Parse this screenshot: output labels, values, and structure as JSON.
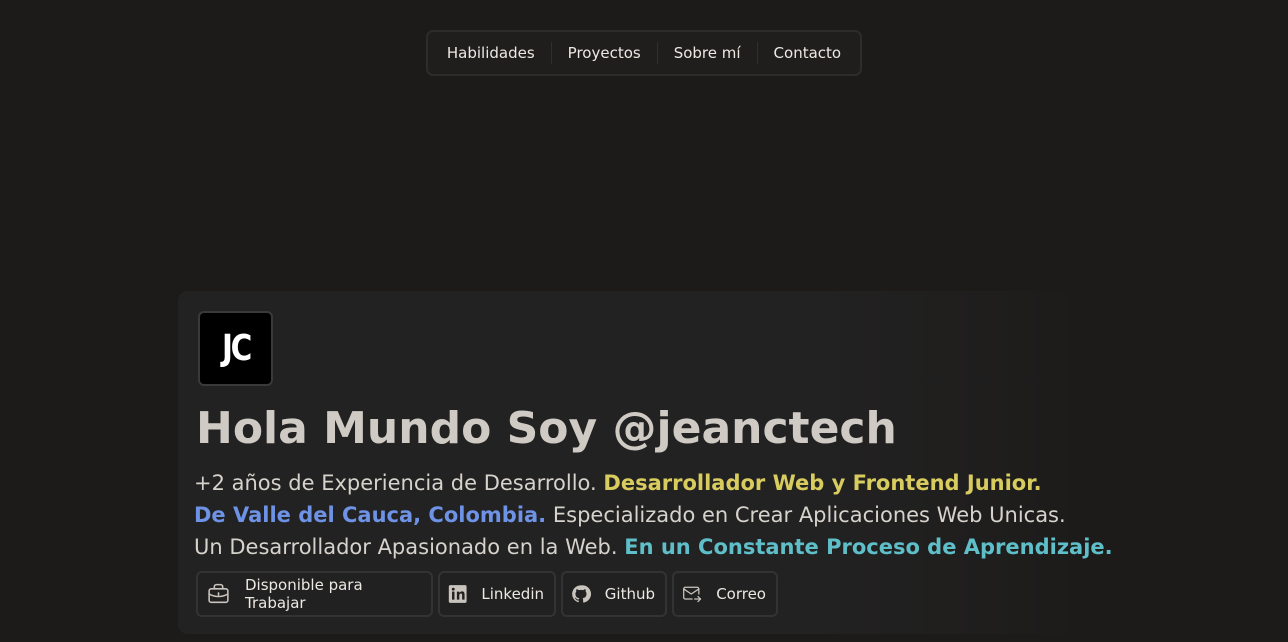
{
  "nav": {
    "items": [
      "Habilidades",
      "Proyectos",
      "Sobre mí",
      "Contacto"
    ]
  },
  "hero": {
    "logo_text": "JC",
    "title": "Hola Mundo Soy @jeanctech",
    "line1_plain": "+2 años de Experiencia de Desarrollo.",
    "line1_highlight": "Desarrollador Web y Frontend Junior.",
    "line2_highlight": "De Valle del Cauca, Colombia.",
    "line2_plain": "Especializado en Crear Aplicaciones Web Unicas.",
    "line3_plain": "Un Desarrollador Apasionado en la Web.",
    "line3_highlight": "En un Constante Proceso de Aprendizaje."
  },
  "buttons": {
    "available": "Disponible para Trabajar",
    "linkedin": "Linkedin",
    "github": "Github",
    "email": "Correo"
  },
  "icons": [
    "briefcase-icon",
    "linkedin-icon",
    "github-icon",
    "mail-send-icon"
  ],
  "colors": {
    "background": "#1c1b1a",
    "highlight_yellow": "#d8cc5e",
    "highlight_blue": "#6e93e6",
    "highlight_cyan": "#5fbfc9"
  }
}
